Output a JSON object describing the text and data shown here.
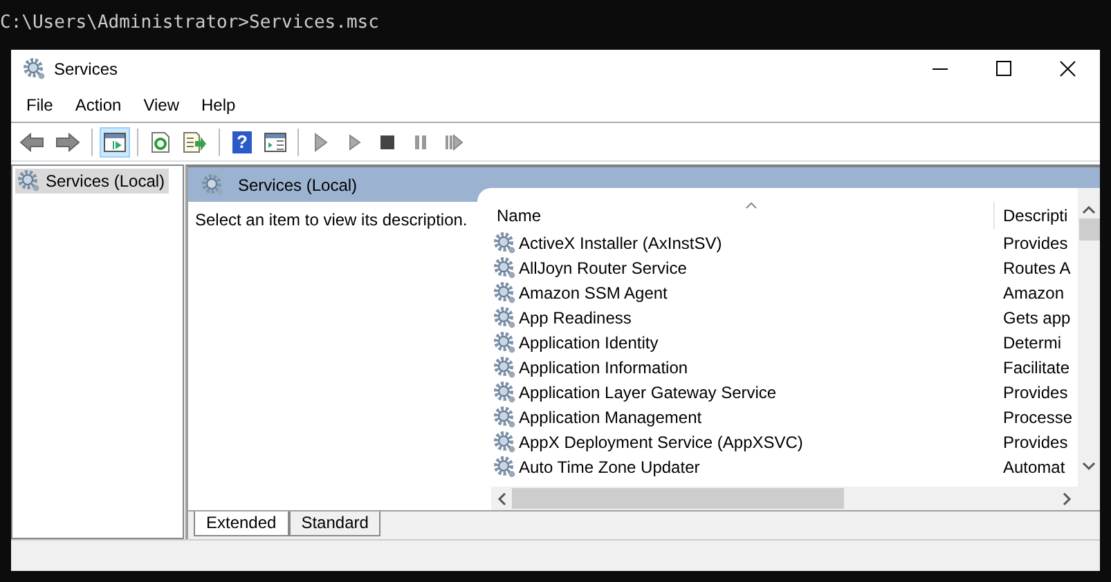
{
  "console": {
    "command_line": "C:\\Users\\Administrator>Services.msc"
  },
  "window": {
    "title": "Services"
  },
  "menu": [
    "File",
    "Action",
    "View",
    "Help"
  ],
  "toolbar": [
    {
      "buttons": [
        {
          "kind": "back",
          "pressed": false
        },
        {
          "kind": "forward",
          "pressed": false
        }
      ]
    },
    {
      "buttons": [
        {
          "kind": "tree",
          "pressed": true
        }
      ]
    },
    {
      "buttons": [
        {
          "kind": "refresh",
          "pressed": false
        },
        {
          "kind": "export",
          "pressed": false
        }
      ]
    },
    {
      "buttons": [
        {
          "kind": "help",
          "pressed": false,
          "glyph": "?"
        },
        {
          "kind": "properties",
          "pressed": false
        }
      ]
    },
    {
      "buttons": [
        {
          "kind": "start",
          "pressed": false
        },
        {
          "kind": "start2",
          "pressed": false
        },
        {
          "kind": "stop",
          "pressed": false
        },
        {
          "kind": "pause",
          "pressed": false
        },
        {
          "kind": "resume",
          "pressed": false
        }
      ]
    }
  ],
  "tree": [
    {
      "label": "Services (Local)",
      "selected": true
    }
  ],
  "pane": {
    "header": "Services (Local)",
    "description": "Select an item to view its description."
  },
  "table": {
    "columns": [
      "Name",
      "Descripti"
    ],
    "rows": [
      {
        "name": "ActiveX Installer (AxInstSV)",
        "description": "Provides"
      },
      {
        "name": "AllJoyn Router Service",
        "description": "Routes A"
      },
      {
        "name": "Amazon SSM Agent",
        "description": "Amazon"
      },
      {
        "name": "App Readiness",
        "description": "Gets app"
      },
      {
        "name": "Application Identity",
        "description": "Determi"
      },
      {
        "name": "Application Information",
        "description": "Facilitate"
      },
      {
        "name": "Application Layer Gateway Service",
        "description": "Provides"
      },
      {
        "name": "Application Management",
        "description": "Processe"
      },
      {
        "name": "AppX Deployment Service (AppXSVC)",
        "description": "Provides"
      },
      {
        "name": "Auto Time Zone Updater",
        "description": "Automat"
      }
    ]
  },
  "view_tabs": [
    {
      "label": "Extended",
      "selected": true
    },
    {
      "label": "Standard",
      "selected": false
    }
  ]
}
